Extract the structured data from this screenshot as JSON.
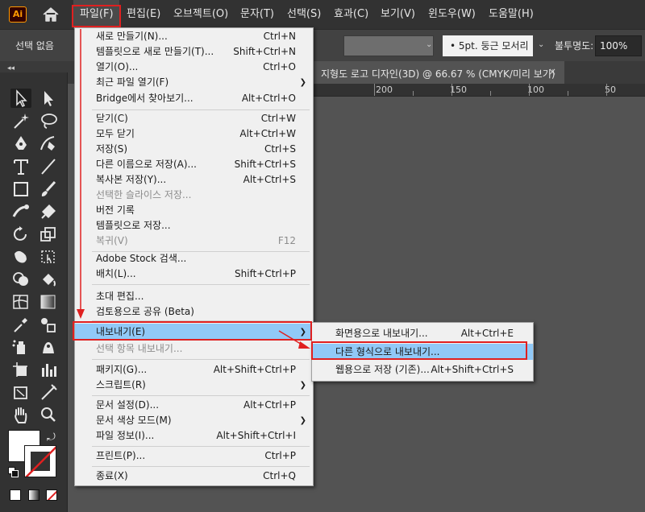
{
  "app": {
    "logo_text": "Ai"
  },
  "menubar": {
    "items": [
      {
        "label": "파일(F)"
      },
      {
        "label": "편집(E)"
      },
      {
        "label": "오브젝트(O)"
      },
      {
        "label": "문자(T)"
      },
      {
        "label": "선택(S)"
      },
      {
        "label": "효과(C)"
      },
      {
        "label": "보기(V)"
      },
      {
        "label": "윈도우(W)"
      },
      {
        "label": "도움말(H)"
      }
    ]
  },
  "control_bar": {
    "selection_label": "선택 없음",
    "brush_select": "5pt. 둥근 모서리",
    "opacity_label": "불투명도:",
    "opacity_value": "100%"
  },
  "document_tab": {
    "title": "지형도 로고 디자인(3D) @ 66.67 % (CMYK/미리 보기)",
    "close_glyph": "×"
  },
  "ruler": {
    "labels": [
      "200",
      "150",
      "100",
      "50"
    ]
  },
  "file_menu": {
    "items": [
      {
        "label": "새로 만들기(N)...",
        "shortcut": "Ctrl+N"
      },
      {
        "label": "템플릿으로 새로 만들기(T)...",
        "shortcut": "Shift+Ctrl+N"
      },
      {
        "label": "열기(O)...",
        "shortcut": "Ctrl+O"
      },
      {
        "label": "최근 파일 열기(F)",
        "shortcut": ""
      },
      {
        "label": "Bridge에서 찾아보기...",
        "shortcut": "Alt+Ctrl+O"
      },
      {
        "label": "닫기(C)",
        "shortcut": "Ctrl+W"
      },
      {
        "label": "모두 닫기",
        "shortcut": "Alt+Ctrl+W"
      },
      {
        "label": "저장(S)",
        "shortcut": "Ctrl+S"
      },
      {
        "label": "다른 이름으로 저장(A)...",
        "shortcut": "Shift+Ctrl+S"
      },
      {
        "label": "복사본 저장(Y)...",
        "shortcut": "Alt+Ctrl+S"
      },
      {
        "label": "선택한 슬라이스 저장...",
        "shortcut": ""
      },
      {
        "label": "버전 기록",
        "shortcut": ""
      },
      {
        "label": "템플릿으로 저장...",
        "shortcut": ""
      },
      {
        "label": "복귀(V)",
        "shortcut": "F12"
      },
      {
        "label": "Adobe Stock 검색...",
        "shortcut": ""
      },
      {
        "label": "배치(L)...",
        "shortcut": "Shift+Ctrl+P"
      },
      {
        "label": "초대 편집...",
        "shortcut": ""
      },
      {
        "label": "검토용으로 공유 (Beta)",
        "shortcut": ""
      },
      {
        "label": "내보내기(E)",
        "shortcut": ""
      },
      {
        "label": "선택 항목 내보내기...",
        "shortcut": ""
      },
      {
        "label": "패키지(G)...",
        "shortcut": "Alt+Shift+Ctrl+P"
      },
      {
        "label": "스크립트(R)",
        "shortcut": ""
      },
      {
        "label": "문서 설정(D)...",
        "shortcut": "Alt+Ctrl+P"
      },
      {
        "label": "문서 색상 모드(M)",
        "shortcut": ""
      },
      {
        "label": "파일 정보(I)...",
        "shortcut": "Alt+Shift+Ctrl+I"
      },
      {
        "label": "프린트(P)...",
        "shortcut": "Ctrl+P"
      },
      {
        "label": "종료(X)",
        "shortcut": "Ctrl+Q"
      }
    ]
  },
  "export_submenu": {
    "items": [
      {
        "label": "화면용으로 내보내기...",
        "shortcut": "Alt+Ctrl+E"
      },
      {
        "label": "다른 형식으로 내보내기...",
        "shortcut": ""
      },
      {
        "label": "웹용으로 저장 (기존)...",
        "shortcut": "Alt+Shift+Ctrl+S"
      }
    ]
  },
  "colors": {
    "annotation_red": "#e02020",
    "menu_highlight": "#91c9f7",
    "logo_orange": "#ff9a00"
  }
}
